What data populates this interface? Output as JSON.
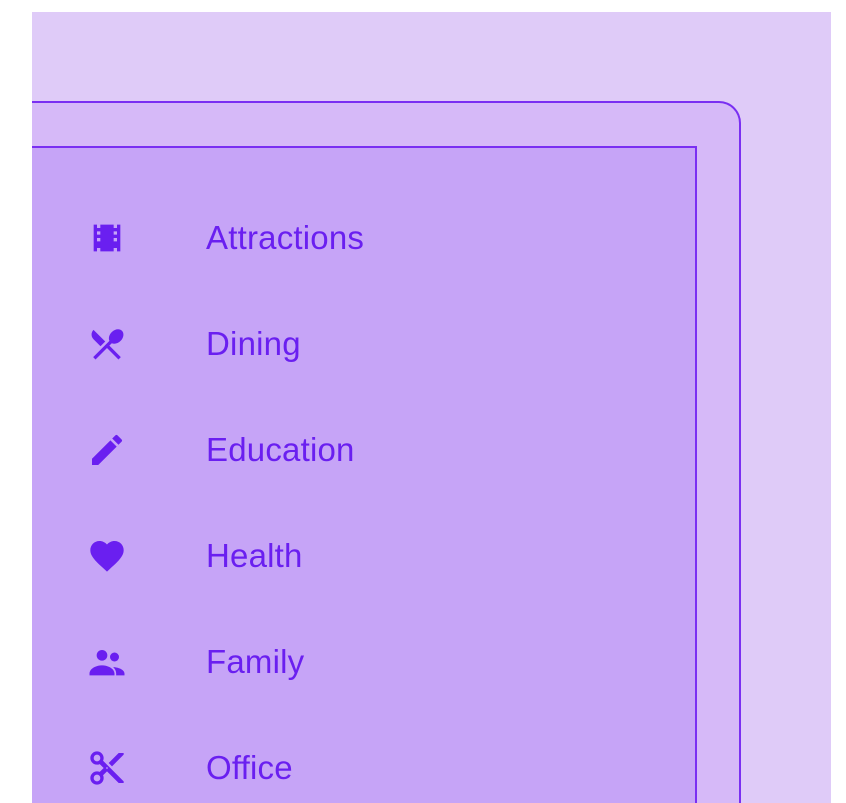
{
  "menu": {
    "items": [
      {
        "label": "Attractions",
        "icon": "movie-film-icon"
      },
      {
        "label": "Dining",
        "icon": "restaurant-icon"
      },
      {
        "label": "Education",
        "icon": "pencil-icon"
      },
      {
        "label": "Health",
        "icon": "heart-icon"
      },
      {
        "label": "Family",
        "icon": "people-icon"
      },
      {
        "label": "Office",
        "icon": "scissors-icon"
      }
    ]
  },
  "colors": {
    "background": "#dfcbf8",
    "outer_panel": "#d6b9f8",
    "inner_panel": "#c6a4f7",
    "accent": "#6a1ff0",
    "border": "#7a2ff2"
  }
}
